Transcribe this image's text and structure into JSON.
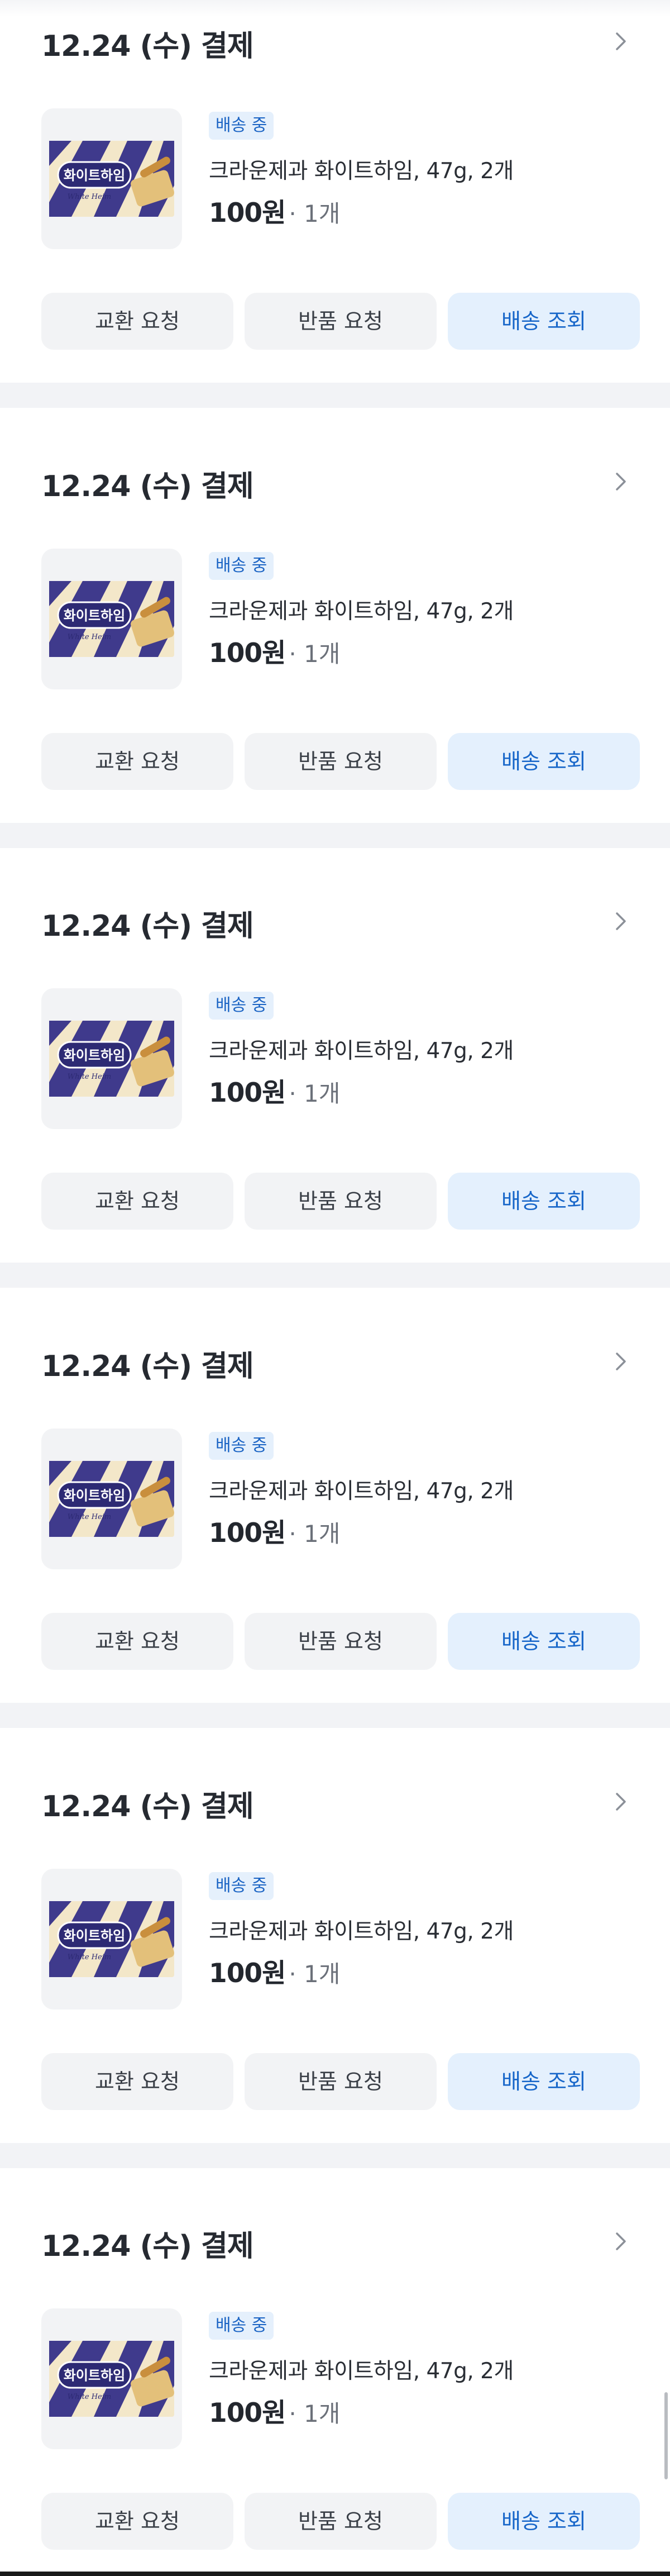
{
  "orders": [
    {
      "date_label": "12.24 (수) 결제",
      "status": "배송 중",
      "product_name": "크라운제과 화이트하임, 47g, 2개",
      "price": "100원",
      "quantity": "· 1개",
      "buttons": {
        "exchange": "교환 요청",
        "return": "반품 요청",
        "track": "배송 조회"
      }
    },
    {
      "date_label": "12.24 (수) 결제",
      "status": "배송 중",
      "product_name": "크라운제과 화이트하임, 47g, 2개",
      "price": "100원",
      "quantity": "· 1개",
      "buttons": {
        "exchange": "교환 요청",
        "return": "반품 요청",
        "track": "배송 조회"
      }
    },
    {
      "date_label": "12.24 (수) 결제",
      "status": "배송 중",
      "product_name": "크라운제과 화이트하임, 47g, 2개",
      "price": "100원",
      "quantity": "· 1개",
      "buttons": {
        "exchange": "교환 요청",
        "return": "반품 요청",
        "track": "배송 조회"
      }
    },
    {
      "date_label": "12.24 (수) 결제",
      "status": "배송 중",
      "product_name": "크라운제과 화이트하임, 47g, 2개",
      "price": "100원",
      "quantity": "· 1개",
      "buttons": {
        "exchange": "교환 요청",
        "return": "반품 요청",
        "track": "배송 조회"
      }
    },
    {
      "date_label": "12.24 (수) 결제",
      "status": "배송 중",
      "product_name": "크라운제과 화이트하임, 47g, 2개",
      "price": "100원",
      "quantity": "· 1개",
      "buttons": {
        "exchange": "교환 요청",
        "return": "반품 요청",
        "track": "배송 조회"
      }
    },
    {
      "date_label": "12.24 (수) 결제",
      "status": "배송 중",
      "product_name": "크라운제과 화이트하임, 47g, 2개",
      "price": "100원",
      "quantity": "· 1개",
      "buttons": {
        "exchange": "교환 요청",
        "return": "반품 요청",
        "track": "배송 조회"
      }
    }
  ],
  "product_image": {
    "package_text": "화이트하임",
    "icon": "wafer-snack-box"
  },
  "colors": {
    "accent_blue": "#1766c9",
    "badge_bg": "#e5f0fc",
    "button_gray_bg": "#f2f3f5",
    "section_divider": "#f2f3f6",
    "package_purple": "#3f3a8c",
    "package_cream": "#f3e7c9"
  }
}
